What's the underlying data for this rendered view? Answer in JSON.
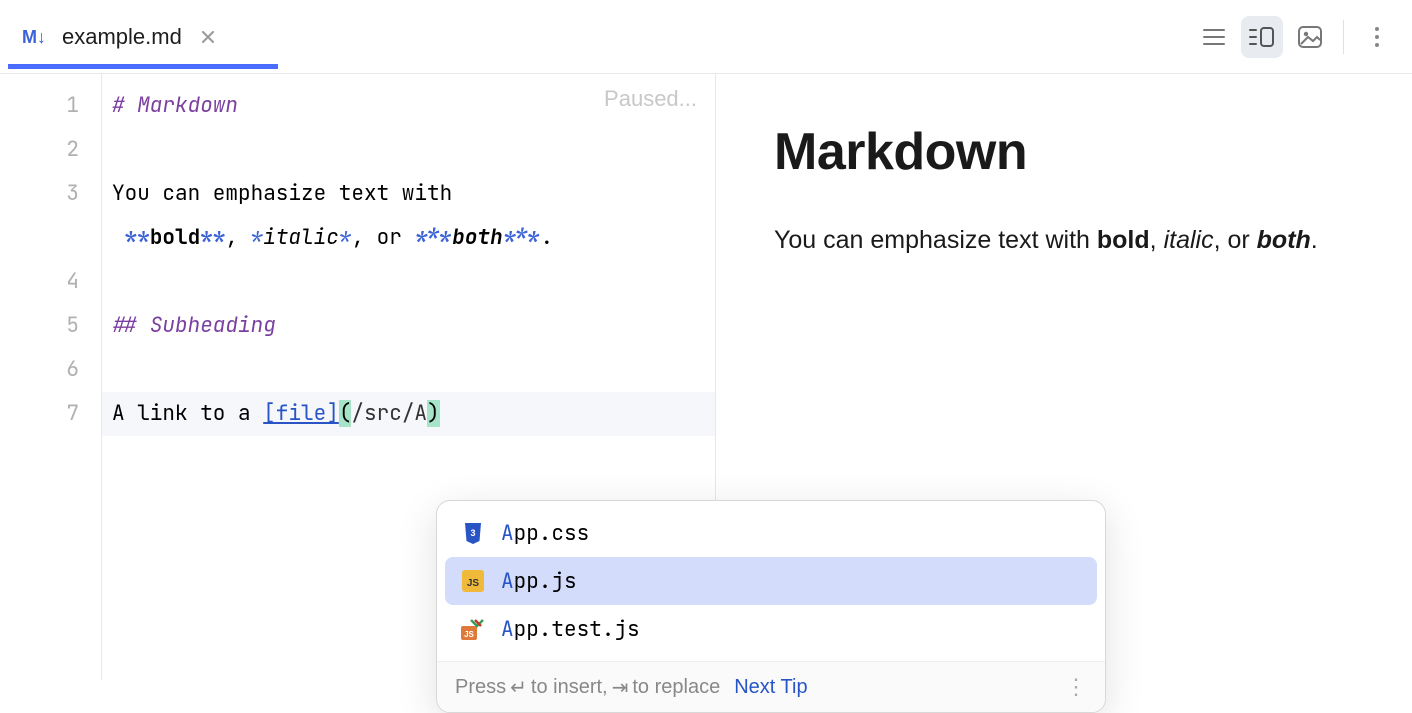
{
  "tab": {
    "filename": "example.md"
  },
  "editor": {
    "paused_label": "Paused...",
    "lines": [
      "1",
      "2",
      "3",
      "4",
      "5",
      "6",
      "7"
    ],
    "l1_hash": "# ",
    "l1_text": "Markdown",
    "l3_pre": "You can emphasize text with ",
    "l3_bold_m1": "**",
    "l3_bold": "bold",
    "l3_bold_m2": "**",
    "l3_c1": ", ",
    "l3_ital_m1": "*",
    "l3_ital": "italic",
    "l3_ital_m2": "*",
    "l3_c2": ", or ",
    "l3_both_m1": "***",
    "l3_both": "both",
    "l3_both_m2": "***",
    "l3_end": ".",
    "l5_hash": "## ",
    "l5_text": "Subheading",
    "l7_pre": "A link to a ",
    "l7_link_label": "[file]",
    "l7_open": "(",
    "l7_url": "/src/A",
    "l7_close": ")"
  },
  "preview": {
    "h1": "Markdown",
    "p_pre": "You can emphasize text with ",
    "p_bold": "bold",
    "p_c1": ", ",
    "p_ital": "italic",
    "p_c2": ", or ",
    "p_both": "both",
    "p_end": "."
  },
  "completion": {
    "items": [
      {
        "match": "A",
        "rest": "pp.css",
        "type": "css"
      },
      {
        "match": "A",
        "rest": "pp.js",
        "type": "js"
      },
      {
        "match": "A",
        "rest": "pp.test.js",
        "type": "testjs"
      }
    ],
    "footer_pre": "Press ",
    "footer_mid": " to insert, ",
    "footer_post": " to replace",
    "next_tip": "Next Tip"
  }
}
